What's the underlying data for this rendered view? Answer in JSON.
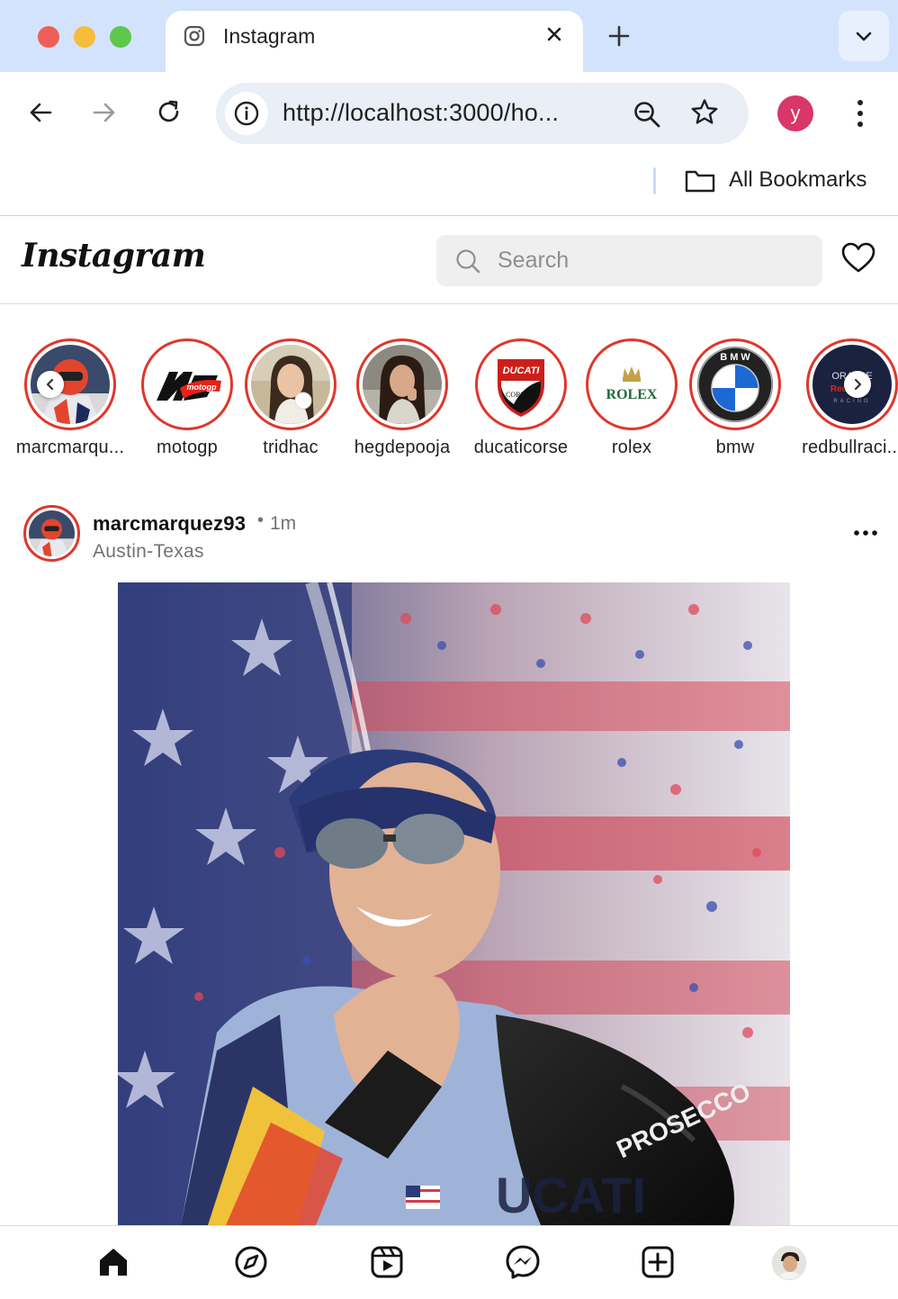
{
  "browser": {
    "tab_title": "Instagram",
    "url": "http://localhost:3000/ho...",
    "profile_initial": "y",
    "bookmarks_label": "All Bookmarks"
  },
  "header": {
    "logo_text": "Instagram",
    "search_placeholder": "Search"
  },
  "stories": [
    {
      "label": "marcmarqu...",
      "icon": "avatar-rider"
    },
    {
      "label": "motogp",
      "icon": "motogp-logo"
    },
    {
      "label": "tridhac",
      "icon": "avatar-woman"
    },
    {
      "label": "hegdepooja",
      "icon": "avatar-woman"
    },
    {
      "label": "ducaticorse",
      "icon": "ducati-logo"
    },
    {
      "label": "rolex",
      "icon": "rolex-logo",
      "logo_text": "ROLEX"
    },
    {
      "label": "bmw",
      "icon": "bmw-logo",
      "logo_text": "B M W"
    },
    {
      "label": "redbullraci...",
      "icon": "redbull-logo",
      "logo_text": "ORACLE Red Bull RACING"
    }
  ],
  "story_logos": {
    "ducati": "DUCATI",
    "ducati_sub": "CORSE"
  },
  "post": {
    "username": "marcmarquez93",
    "separator": "•",
    "time": "1m",
    "location": "Austin-Texas"
  },
  "colors": {
    "story_ring": "#e0362c",
    "chrome_bg": "#d3e3fd",
    "profile_bg": "#d9366a"
  },
  "bottom_nav": [
    "home-icon",
    "explore-icon",
    "reels-icon",
    "messenger-icon",
    "create-icon",
    "profile-avatar"
  ]
}
